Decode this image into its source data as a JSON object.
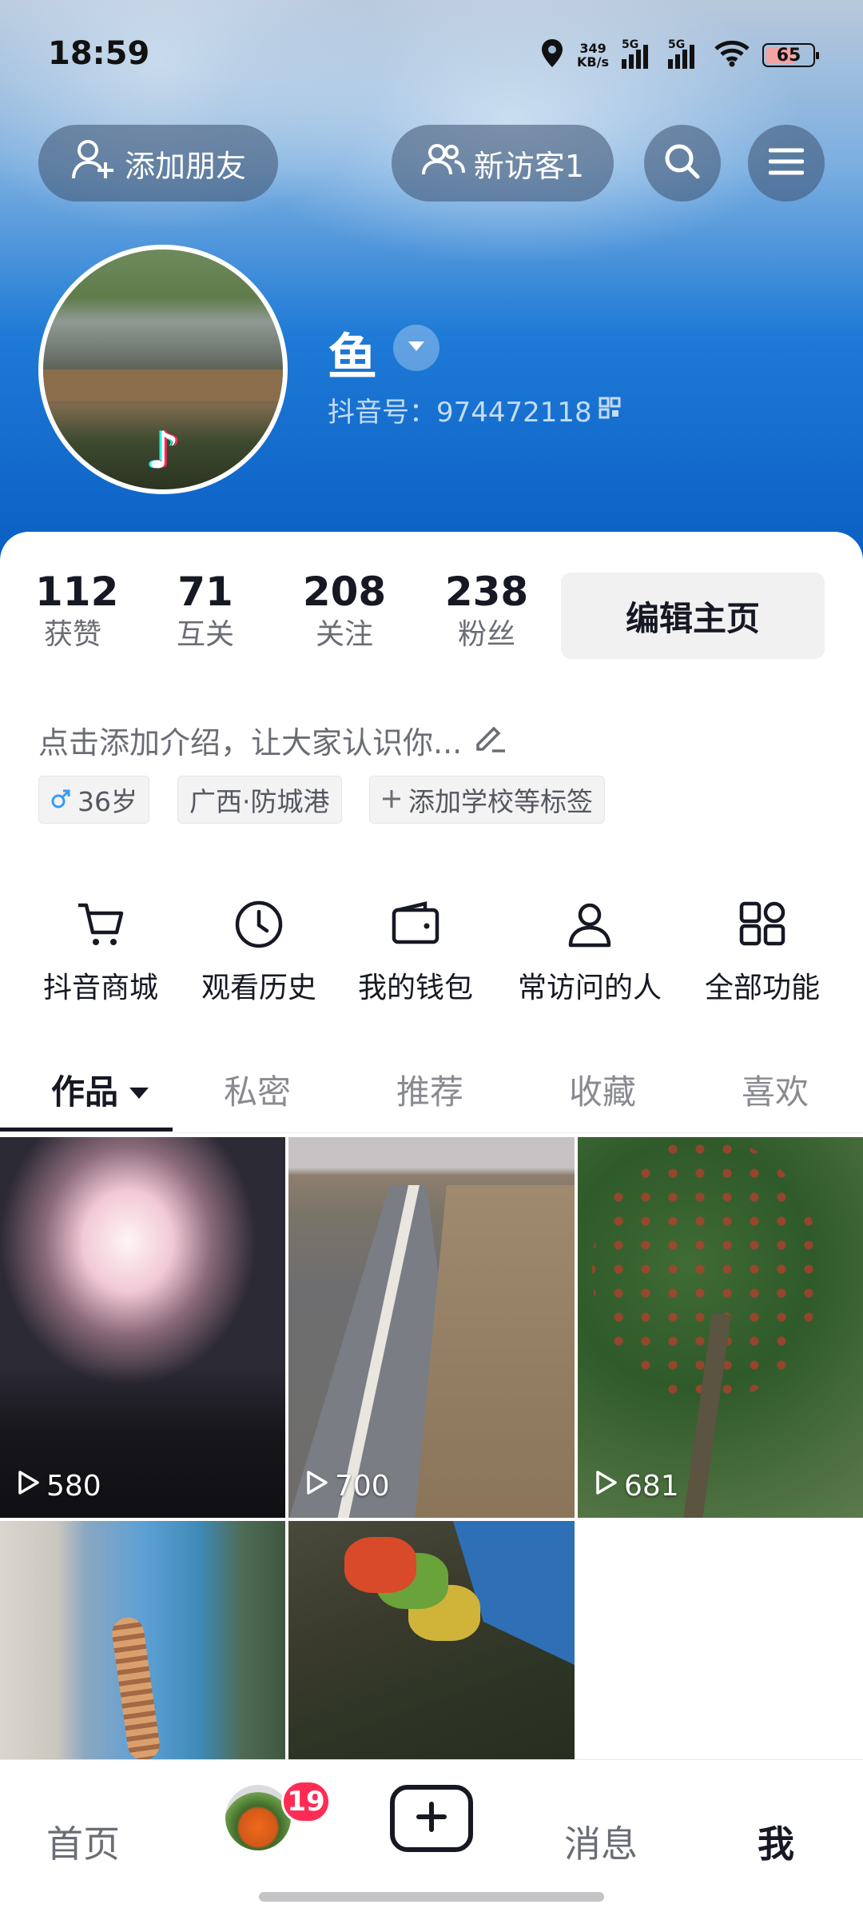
{
  "status_bar": {
    "time": "18:59",
    "net_speed_value": "349",
    "net_speed_unit": "KB/s",
    "network1": "5G",
    "network2": "5G",
    "battery": "65"
  },
  "header": {
    "add_friend_label": "添加朋友",
    "new_visitors_label": "新访客1"
  },
  "profile": {
    "username": "鱼",
    "douyin_id": "抖音号：974472118"
  },
  "stats": [
    {
      "value": "112",
      "label": "获赞"
    },
    {
      "value": "71",
      "label": "互关"
    },
    {
      "value": "208",
      "label": "关注"
    },
    {
      "value": "238",
      "label": "粉丝"
    }
  ],
  "edit_profile_label": "编辑主页",
  "bio_placeholder": "点击添加介绍，让大家认识你...",
  "tags": {
    "age": "36岁",
    "location": "广西·防城港",
    "add_tag": "添加学校等标签"
  },
  "functions": [
    {
      "label": "抖音商城",
      "icon": "cart-icon"
    },
    {
      "label": "观看历史",
      "icon": "clock-icon"
    },
    {
      "label": "我的钱包",
      "icon": "wallet-icon"
    },
    {
      "label": "常访问的人",
      "icon": "person-icon"
    },
    {
      "label": "全部功能",
      "icon": "grid-icon"
    }
  ],
  "tabs": [
    {
      "label": "作品"
    },
    {
      "label": "私密"
    },
    {
      "label": "推荐"
    },
    {
      "label": "收藏"
    },
    {
      "label": "喜欢"
    }
  ],
  "videos": [
    {
      "plays": "580"
    },
    {
      "plays": "700"
    },
    {
      "plays": "681"
    }
  ],
  "bottom_nav": {
    "home": "首页",
    "friends_badge": "19",
    "messages": "消息",
    "me": "我"
  },
  "colors": {
    "accent_red": "#fe2c55",
    "header_blue": "#1e7ad6"
  }
}
